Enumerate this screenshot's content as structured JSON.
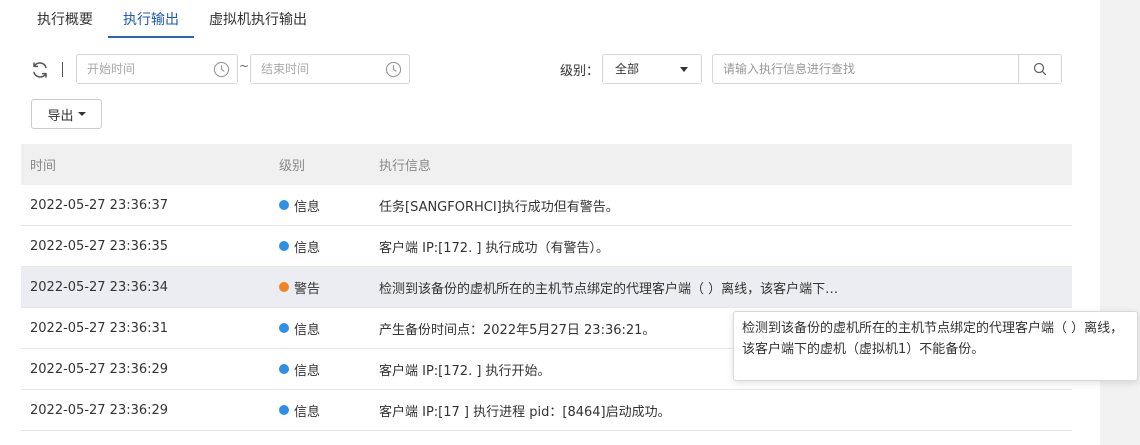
{
  "tabs": [
    {
      "label": "执行概要",
      "active": false
    },
    {
      "label": "执行输出",
      "active": true
    },
    {
      "label": "虚拟机执行输出",
      "active": false
    }
  ],
  "filters": {
    "start_placeholder": "开始时间",
    "end_placeholder": "结束时间",
    "separator": "~",
    "level_label": "级别：",
    "level_value": "全部",
    "search_placeholder": "请输入执行信息进行查找"
  },
  "export_label": "导出",
  "table": {
    "columns": [
      "时间",
      "级别",
      "执行信息"
    ],
    "rows": [
      {
        "time": "2022-05-27 23:36:37",
        "level": "信息",
        "type": "info",
        "message": "任务[SANGFORHCI]执行成功但有警告。"
      },
      {
        "time": "2022-05-27 23:36:35",
        "level": "信息",
        "type": "info",
        "message": "客户端 IP:[172.            ] 执行成功（有警告）。"
      },
      {
        "time": "2022-05-27 23:36:34",
        "level": "警告",
        "type": "warn",
        "message": "检测到该备份的虚机所在的主机节点绑定的代理客户端（            ）离线，该客户端下…"
      },
      {
        "time": "2022-05-27 23:36:31",
        "level": "信息",
        "type": "info",
        "message": "产生备份时间点：2022年5月27日 23:36:21。"
      },
      {
        "time": "2022-05-27 23:36:29",
        "level": "信息",
        "type": "info",
        "message": "客户端 IP:[172.            ] 执行开始。"
      },
      {
        "time": "2022-05-27 23:36:29",
        "level": "信息",
        "type": "info",
        "message": "客户端 IP:[17            ] 执行进程 pid：[8464]启动成功。"
      }
    ]
  },
  "tooltip": {
    "text": "检测到该备份的虚机所在的主机节点绑定的代理客户端（            ）离线，该客户端下的虚机（虚拟机1）不能备份。"
  },
  "colors": {
    "accent": "#2a64c0",
    "info": "#2d8fe8",
    "warn": "#f5841f"
  }
}
